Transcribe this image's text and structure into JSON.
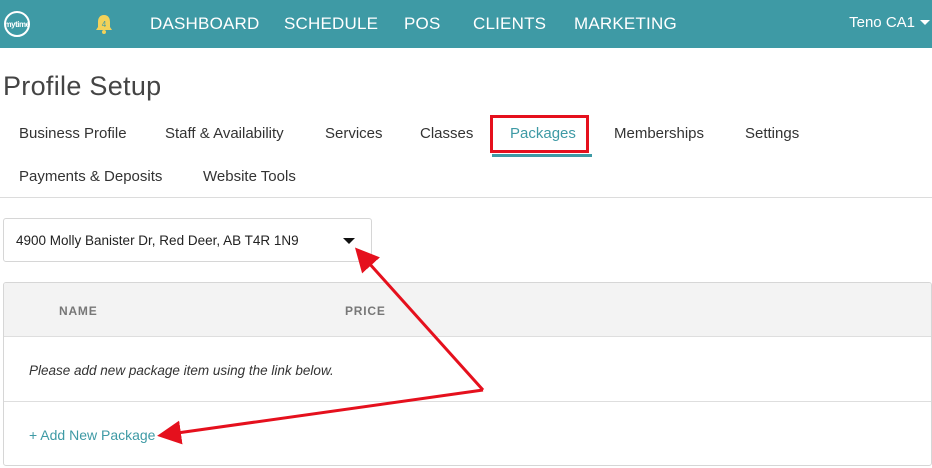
{
  "topbar": {
    "logo_text": "mytime",
    "notification_count": "4",
    "nav": [
      "DASHBOARD",
      "SCHEDULE",
      "POS",
      "CLIENTS",
      "MARKETING"
    ],
    "user_name": "Teno CA1",
    "bg_color": "#3e9aa5"
  },
  "page": {
    "title": "Profile Setup"
  },
  "tabs": [
    {
      "label": "Business Profile"
    },
    {
      "label": "Staff & Availability"
    },
    {
      "label": "Services"
    },
    {
      "label": "Classes"
    },
    {
      "label": "Packages",
      "active": true
    },
    {
      "label": "Memberships"
    },
    {
      "label": "Settings"
    },
    {
      "label": "Payments & Deposits"
    },
    {
      "label": "Website Tools"
    }
  ],
  "location_select": {
    "value": "4900 Molly Banister Dr, Red Deer, AB T4R 1N9"
  },
  "packages_table": {
    "columns": [
      "NAME",
      "PRICE"
    ],
    "empty_message": "Please add new package item using the link below.",
    "add_link": "+ Add New Package"
  },
  "annotation": {
    "highlight_color": "#e5101d"
  }
}
